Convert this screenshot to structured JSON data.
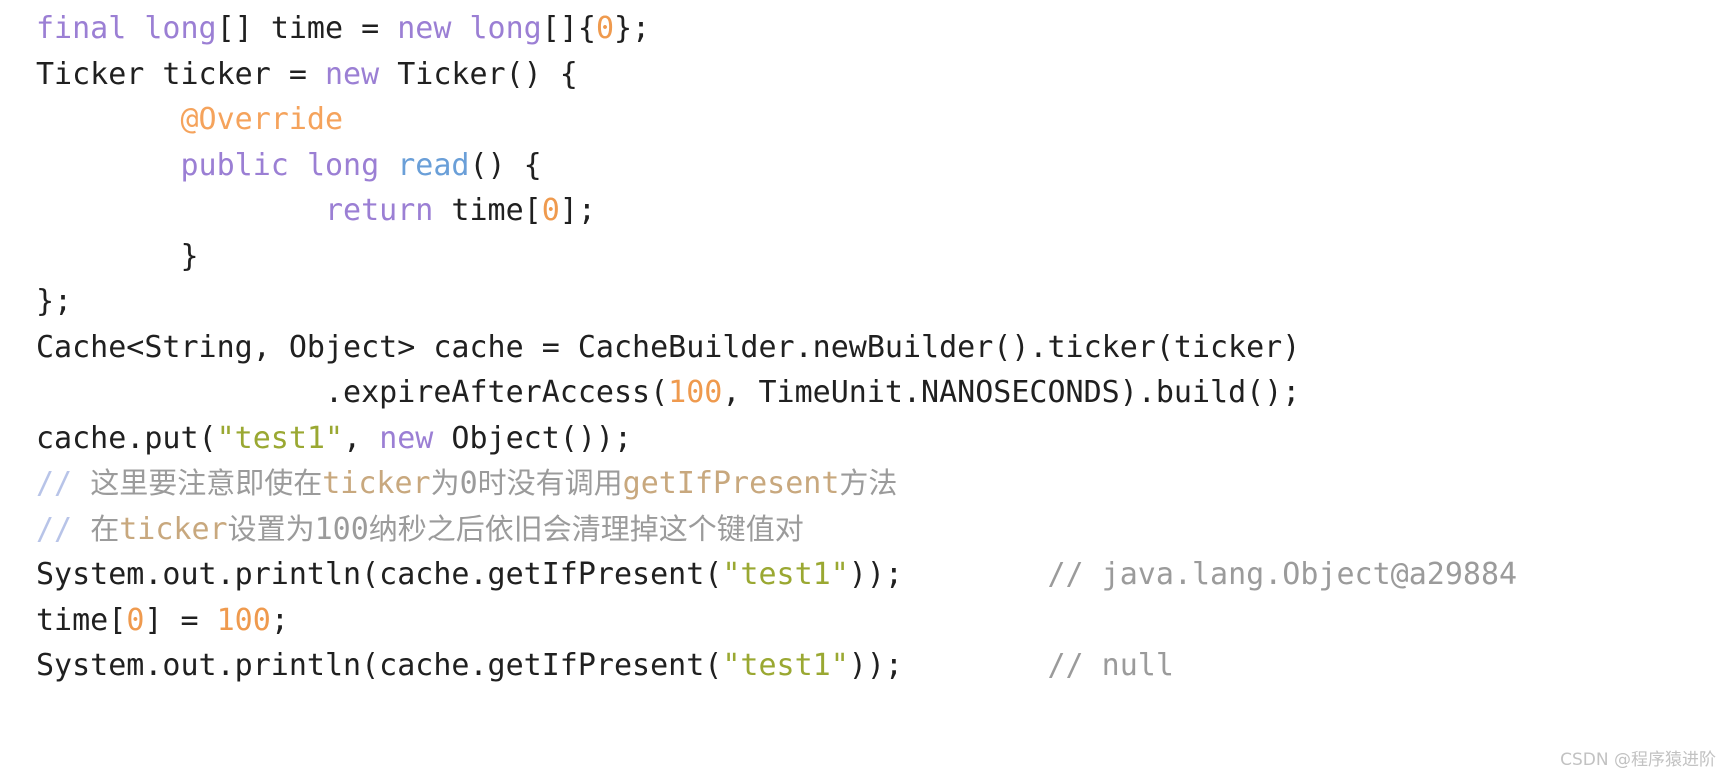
{
  "editor": {
    "language": "java",
    "background_color": "#ffffff",
    "default_text_color": "#202020",
    "theme_colors": {
      "keyword": "#9b7fd4",
      "annotation": "#f5a35c",
      "number": "#ef9a4e",
      "method": "#6a9fd8",
      "string": "#9aa832",
      "comment": "#9b9b9b",
      "comment_slash": "#b8c4e8",
      "comment_code": "#c8a87e"
    }
  },
  "code": {
    "lines": [
      {
        "index": 1,
        "text": "final long[] time = new long[]{0};",
        "tokens": [
          {
            "t": "final",
            "c": "keyword"
          },
          {
            "t": " ",
            "c": "plain"
          },
          {
            "t": "long",
            "c": "keyword"
          },
          {
            "t": "[] ",
            "c": "plain"
          },
          {
            "t": "time",
            "c": "plain"
          },
          {
            "t": " = ",
            "c": "plain"
          },
          {
            "t": "new",
            "c": "keyword"
          },
          {
            "t": " ",
            "c": "plain"
          },
          {
            "t": "long",
            "c": "keyword"
          },
          {
            "t": "[]{",
            "c": "plain"
          },
          {
            "t": "0",
            "c": "number"
          },
          {
            "t": "};",
            "c": "plain"
          }
        ]
      },
      {
        "index": 2,
        "text": "Ticker ticker = new Ticker() {",
        "tokens": [
          {
            "t": "Ticker ticker = ",
            "c": "plain"
          },
          {
            "t": "new",
            "c": "keyword"
          },
          {
            "t": " Ticker() {",
            "c": "plain"
          }
        ]
      },
      {
        "index": 3,
        "text": "        @Override",
        "tokens": [
          {
            "t": "        ",
            "c": "plain"
          },
          {
            "t": "@Override",
            "c": "annotation"
          }
        ]
      },
      {
        "index": 4,
        "text": "        public long read() {",
        "tokens": [
          {
            "t": "        ",
            "c": "plain"
          },
          {
            "t": "public",
            "c": "keyword"
          },
          {
            "t": " ",
            "c": "plain"
          },
          {
            "t": "long",
            "c": "keyword"
          },
          {
            "t": " ",
            "c": "plain"
          },
          {
            "t": "read",
            "c": "method"
          },
          {
            "t": "() {",
            "c": "plain"
          }
        ]
      },
      {
        "index": 5,
        "text": "                return time[0];",
        "tokens": [
          {
            "t": "                ",
            "c": "plain"
          },
          {
            "t": "return",
            "c": "keyword"
          },
          {
            "t": " time[",
            "c": "plain"
          },
          {
            "t": "0",
            "c": "number"
          },
          {
            "t": "];",
            "c": "plain"
          }
        ]
      },
      {
        "index": 6,
        "text": "        }",
        "tokens": [
          {
            "t": "        }",
            "c": "plain"
          }
        ]
      },
      {
        "index": 7,
        "text": "};",
        "tokens": [
          {
            "t": "};",
            "c": "plain"
          }
        ]
      },
      {
        "index": 8,
        "text": "Cache<String, Object> cache = CacheBuilder.newBuilder().ticker(ticker)",
        "tokens": [
          {
            "t": "Cache<String, Object> cache = CacheBuilder.newBuilder().ticker(ticker)",
            "c": "plain"
          }
        ]
      },
      {
        "index": 9,
        "text": "                .expireAfterAccess(100, TimeUnit.NANOSECONDS).build();",
        "tokens": [
          {
            "t": "                .expireAfterAccess(",
            "c": "plain"
          },
          {
            "t": "100",
            "c": "number"
          },
          {
            "t": ", TimeUnit.NANOSECONDS).build();",
            "c": "plain"
          }
        ]
      },
      {
        "index": 10,
        "text": "cache.put(\"test1\", new Object());",
        "tokens": [
          {
            "t": "cache.put(",
            "c": "plain"
          },
          {
            "t": "\"test1\"",
            "c": "string"
          },
          {
            "t": ", ",
            "c": "plain"
          },
          {
            "t": "new",
            "c": "keyword"
          },
          {
            "t": " Object());",
            "c": "plain"
          }
        ]
      },
      {
        "index": 11,
        "text": "// 这里要注意即使在ticker为0时没有调用getIfPresent方法",
        "comment": true,
        "tokens": [
          {
            "t": "// ",
            "c": "comment-slash"
          },
          {
            "t": "这里要注意即使在",
            "c": "comment",
            "cjk": true
          },
          {
            "t": "ticker",
            "c": "comment-code"
          },
          {
            "t": "为",
            "c": "comment",
            "cjk": true
          },
          {
            "t": "0",
            "c": "comment"
          },
          {
            "t": "时没有调用",
            "c": "comment",
            "cjk": true
          },
          {
            "t": "getIfPresent",
            "c": "comment-code"
          },
          {
            "t": "方法",
            "c": "comment",
            "cjk": true
          }
        ]
      },
      {
        "index": 12,
        "text": "// 在ticker设置为100纳秒之后依旧会清理掉这个键值对",
        "comment": true,
        "tokens": [
          {
            "t": "// ",
            "c": "comment-slash"
          },
          {
            "t": "在",
            "c": "comment",
            "cjk": true
          },
          {
            "t": "ticker",
            "c": "comment-code"
          },
          {
            "t": "设置为",
            "c": "comment",
            "cjk": true
          },
          {
            "t": "100",
            "c": "comment"
          },
          {
            "t": "纳秒之后依旧会清理掉这个键值对",
            "c": "comment",
            "cjk": true
          }
        ]
      },
      {
        "index": 13,
        "text": "System.out.println(cache.getIfPresent(\"test1\"));        // java.lang.Object@a29884",
        "tokens": [
          {
            "t": "System.out.println(cache.getIfPresent(",
            "c": "plain"
          },
          {
            "t": "\"test1\"",
            "c": "string"
          },
          {
            "t": "));        ",
            "c": "plain"
          },
          {
            "t": "// java.lang.Object@a29884",
            "c": "comment"
          }
        ]
      },
      {
        "index": 14,
        "text": "time[0] = 100;",
        "tokens": [
          {
            "t": "time[",
            "c": "plain"
          },
          {
            "t": "0",
            "c": "number"
          },
          {
            "t": "] = ",
            "c": "plain"
          },
          {
            "t": "100",
            "c": "number"
          },
          {
            "t": ";",
            "c": "plain"
          }
        ]
      },
      {
        "index": 15,
        "text": "System.out.println(cache.getIfPresent(\"test1\"));        // null",
        "tokens": [
          {
            "t": "System.out.println(cache.getIfPresent(",
            "c": "plain"
          },
          {
            "t": "\"test1\"",
            "c": "string"
          },
          {
            "t": "));        ",
            "c": "plain"
          },
          {
            "t": "// null",
            "c": "comment"
          }
        ]
      }
    ]
  },
  "watermark": {
    "text": "CSDN @程序猿进阶"
  }
}
